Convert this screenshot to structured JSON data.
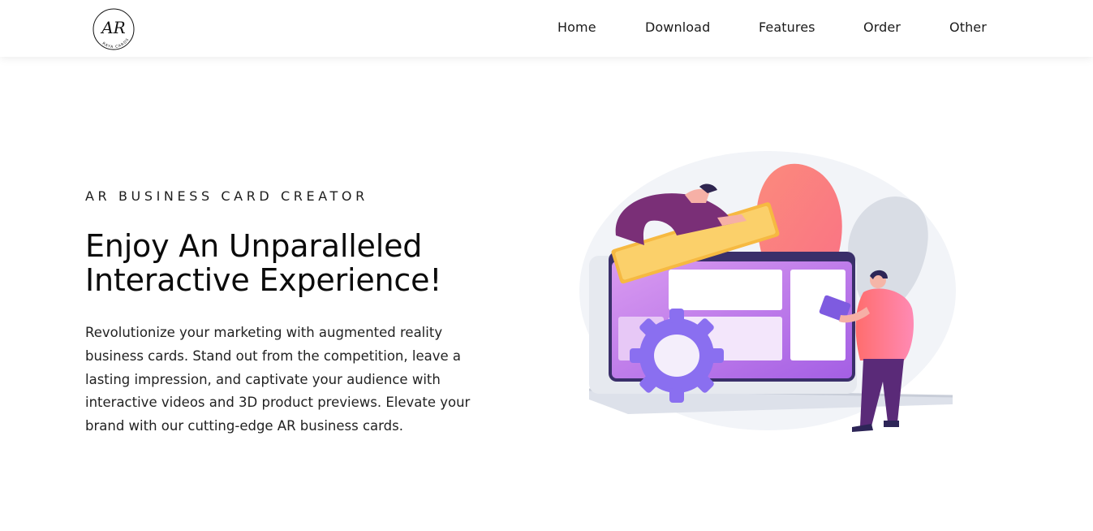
{
  "header": {
    "logo": {
      "monogram": "AR",
      "tagline": "RAYA CARDS"
    },
    "nav": {
      "home": "Home",
      "download": "Download",
      "features": "Features",
      "order": "Order",
      "other": "Other"
    }
  },
  "hero": {
    "eyebrow": "AR BUSINESS CARD CREATOR",
    "headline_line1": "Enjoy An Unparalleled",
    "headline_line2": "Interactive Experience!",
    "description": "Revolutionize your marketing with augmented reality business cards. Stand out from the competition, leave a lasting impression, and captivate your audience with interactive videos and 3D product previews. Elevate your brand with our cutting-edge AR business cards."
  },
  "colors": {
    "text": "#111111",
    "nav_text": "#1b1b1b",
    "illustration_purple": "#a25de0",
    "illustration_coral": "#fa7f7a",
    "illustration_yellow": "#f9c74f",
    "illustration_pink": "#ff6f9c",
    "illustration_gray": "#dfe3ea"
  },
  "illustration": {
    "name": "ar-interface-illustration"
  }
}
